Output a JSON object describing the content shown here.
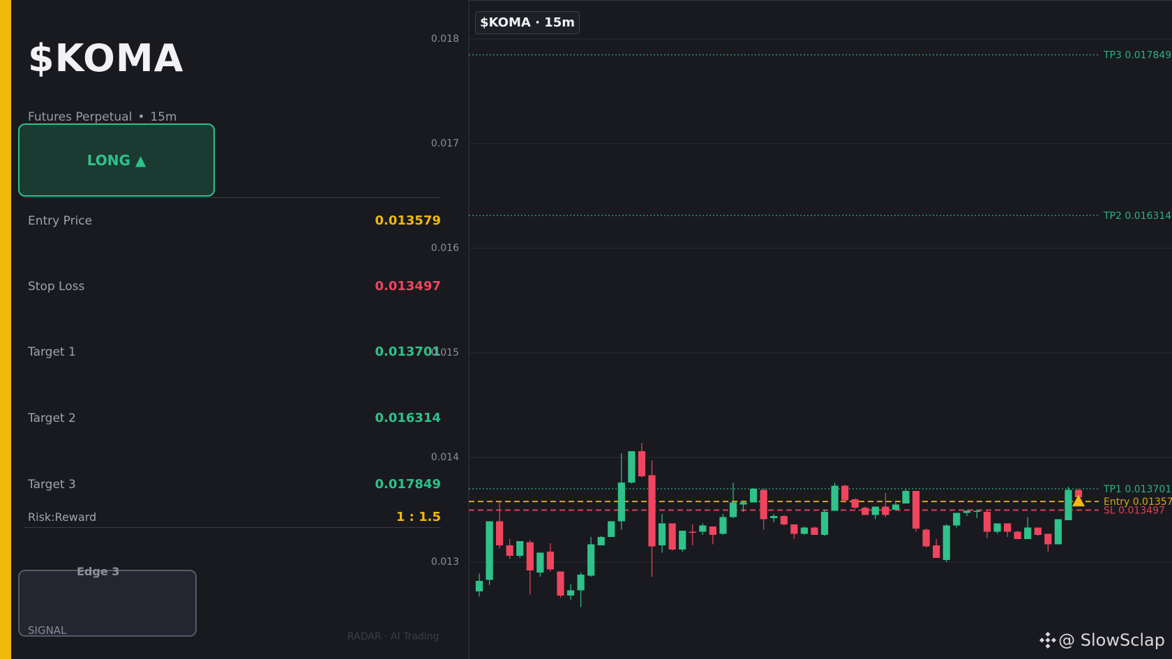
{
  "panel": {
    "ticker": "$KOMA",
    "market": "Futures Perpetual",
    "separator": "•",
    "timeframe": "15m",
    "direction": "LONG ▲",
    "rows": [
      {
        "label": "Entry Price",
        "value": "0.013579",
        "color": "#f0b90b"
      },
      {
        "label": "Stop Loss",
        "value": "0.013497",
        "color": "#f0455f"
      },
      {
        "label": "Target 1",
        "value": "0.013701",
        "color": "#2fc28a"
      },
      {
        "label": "Target 2",
        "value": "0.016314",
        "color": "#2fc28a"
      },
      {
        "label": "Target 3",
        "value": "0.017849",
        "color": "#2fc28a"
      }
    ],
    "risk_reward": {
      "label": "Risk:Reward",
      "value": "1 : 1.5"
    },
    "edge_label": "Edge 3",
    "signal_label": "SIGNAL",
    "footer_note": "RADAR · AI Trading"
  },
  "chart": {
    "title": "$KOMA · 15m",
    "watermark": "@ SlowSclap",
    "watermark_icon": "binance-logo-icon"
  },
  "colors": {
    "accent": "#f0b90b",
    "up": "#2fc28a",
    "down": "#f0455f",
    "entry": "#f0b90b",
    "stop": "#f0455f",
    "target": "#2fc28a"
  },
  "chart_data": {
    "type": "candlestick",
    "title": "$KOMA · 15m",
    "ylim": [
      0.0123,
      0.0183
    ],
    "yticks": [
      "0.018",
      "0.017",
      "0.016",
      "0.015",
      "0.014",
      "0.013"
    ],
    "yticks_values": [
      0.018,
      0.017,
      0.016,
      0.015,
      0.014,
      0.013
    ],
    "grid": true,
    "levels": [
      {
        "label": "TP3 0.017849",
        "value": 0.017849,
        "style": "dotted",
        "color": "#2fc28a"
      },
      {
        "label": "TP2 0.016314",
        "value": 0.016314,
        "style": "dotted",
        "color": "#2fc28a"
      },
      {
        "label": "TP1 0.013701",
        "value": 0.013701,
        "style": "dotted",
        "color": "#2fc28a"
      },
      {
        "label": "Entry 0.013579",
        "value": 0.013579,
        "style": "dashed",
        "color": "#f0b90b"
      },
      {
        "label": "SL 0.013497",
        "value": 0.013497,
        "style": "dashed",
        "color": "#f0455f"
      }
    ],
    "candles": [
      [
        0.01272,
        0.01282,
        0.01267,
        0.01289
      ],
      [
        0.01283,
        0.01339,
        0.01278,
        0.01339
      ],
      [
        0.01339,
        0.01316,
        0.01313,
        0.01358
      ],
      [
        0.01316,
        0.01306,
        0.01303,
        0.01322
      ],
      [
        0.01306,
        0.0132,
        0.01304,
        0.0132
      ],
      [
        0.01319,
        0.01292,
        0.01269,
        0.01321
      ],
      [
        0.0129,
        0.01309,
        0.01286,
        0.01309
      ],
      [
        0.0131,
        0.01293,
        0.01291,
        0.01318
      ],
      [
        0.01291,
        0.01268,
        0.01266,
        0.01291
      ],
      [
        0.01268,
        0.01273,
        0.01264,
        0.01279
      ],
      [
        0.01273,
        0.01288,
        0.01257,
        0.0129
      ],
      [
        0.01287,
        0.01317,
        0.01286,
        0.01324
      ],
      [
        0.01316,
        0.01324,
        0.01316,
        0.01325
      ],
      [
        0.01324,
        0.01339,
        0.01324,
        0.01339
      ],
      [
        0.01339,
        0.01376,
        0.01331,
        0.01404
      ],
      [
        0.01376,
        0.01406,
        0.01375,
        0.01406
      ],
      [
        0.01406,
        0.01382,
        0.01381,
        0.01414
      ],
      [
        0.01383,
        0.01315,
        0.01286,
        0.01397
      ],
      [
        0.01316,
        0.01337,
        0.01309,
        0.01346
      ],
      [
        0.01337,
        0.01312,
        0.01311,
        0.01337
      ],
      [
        0.01312,
        0.0133,
        0.0131,
        0.0133
      ],
      [
        0.01329,
        0.01328,
        0.01316,
        0.01336
      ],
      [
        0.01329,
        0.01335,
        0.01326,
        0.01337
      ],
      [
        0.01334,
        0.01326,
        0.01317,
        0.01334
      ],
      [
        0.01327,
        0.01343,
        0.01326,
        0.01346
      ],
      [
        0.01343,
        0.01357,
        0.01342,
        0.01376
      ],
      [
        0.01355,
        0.01357,
        0.01348,
        0.01359
      ],
      [
        0.01357,
        0.0137,
        0.01357,
        0.01371
      ],
      [
        0.01369,
        0.01341,
        0.01331,
        0.0137
      ],
      [
        0.01342,
        0.01344,
        0.01338,
        0.01346
      ],
      [
        0.01344,
        0.01336,
        0.01335,
        0.01345
      ],
      [
        0.01336,
        0.01327,
        0.01322,
        0.01336
      ],
      [
        0.01327,
        0.01333,
        0.01326,
        0.01334
      ],
      [
        0.01333,
        0.01326,
        0.01326,
        0.01334
      ],
      [
        0.01326,
        0.01348,
        0.01325,
        0.0135
      ],
      [
        0.01349,
        0.01373,
        0.01349,
        0.01376
      ],
      [
        0.01373,
        0.01359,
        0.01357,
        0.01374
      ],
      [
        0.0136,
        0.01352,
        0.01351,
        0.01361
      ],
      [
        0.01352,
        0.01345,
        0.01345,
        0.01353
      ],
      [
        0.01345,
        0.01353,
        0.01341,
        0.01353
      ],
      [
        0.01353,
        0.01345,
        0.01343,
        0.01366
      ],
      [
        0.0135,
        0.01355,
        0.0135,
        0.01357
      ],
      [
        0.01356,
        0.01368,
        0.01356,
        0.0137
      ],
      [
        0.01368,
        0.01332,
        0.01329,
        0.01368
      ],
      [
        0.01331,
        0.01315,
        0.01314,
        0.01332
      ],
      [
        0.01316,
        0.01304,
        0.01304,
        0.01322
      ],
      [
        0.01302,
        0.01335,
        0.013,
        0.01336
      ],
      [
        0.01335,
        0.01347,
        0.01333,
        0.01347
      ],
      [
        0.01347,
        0.01349,
        0.01344,
        0.0135
      ],
      [
        0.01349,
        0.01349,
        0.01342,
        0.0135
      ],
      [
        0.01348,
        0.01329,
        0.01323,
        0.01349
      ],
      [
        0.01329,
        0.01337,
        0.01327,
        0.01337
      ],
      [
        0.01337,
        0.01329,
        0.01324,
        0.01337
      ],
      [
        0.01329,
        0.01322,
        0.01322,
        0.0133
      ],
      [
        0.01322,
        0.01333,
        0.01322,
        0.01343
      ],
      [
        0.01333,
        0.01326,
        0.01325,
        0.01333
      ],
      [
        0.01327,
        0.01317,
        0.0131,
        0.01327
      ],
      [
        0.01317,
        0.01341,
        0.01317,
        0.01341
      ],
      [
        0.0134,
        0.01369,
        0.0134,
        0.01372
      ],
      [
        0.01369,
        0.01362,
        0.0136,
        0.0137
      ]
    ],
    "candle_fields": [
      "open",
      "close",
      "low",
      "high"
    ],
    "marker": {
      "type": "triangle-up",
      "value": 0.013579,
      "color": "#f0b90b"
    }
  }
}
